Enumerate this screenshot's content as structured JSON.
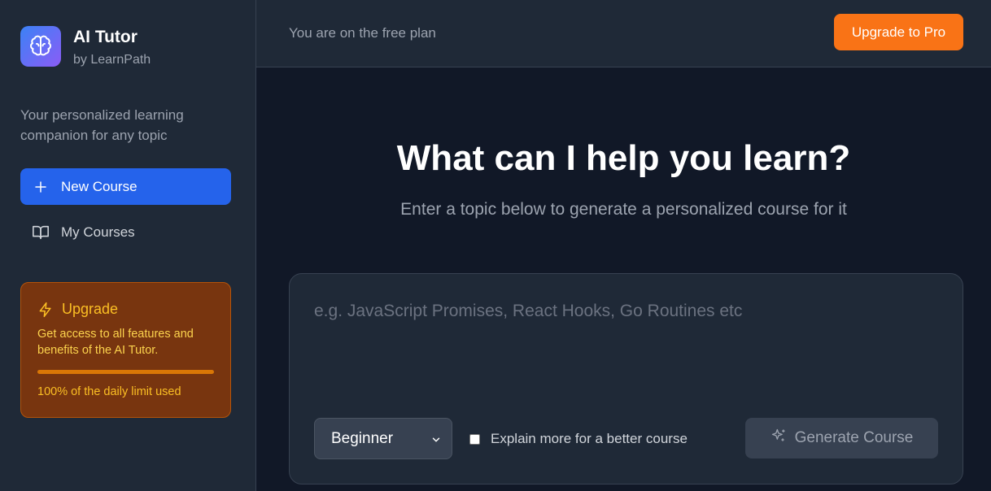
{
  "brand": {
    "title": "AI Tutor",
    "subtitle": "by LearnPath",
    "logo_icon": "brain-icon"
  },
  "sidebar": {
    "tagline": "Your personalized learning companion for any topic",
    "items": [
      {
        "label": "New Course",
        "icon": "plus-icon",
        "active": true
      },
      {
        "label": "My Courses",
        "icon": "book-open-icon",
        "active": false
      }
    ],
    "upgrade": {
      "title": "Upgrade",
      "icon": "lightning-icon",
      "description": "Get access to all features and benefits of the AI Tutor.",
      "usage_fraction": 1.0,
      "usage_text": "100% of the daily limit used"
    }
  },
  "header": {
    "plan_text": "You are on the free plan",
    "upgrade_button": "Upgrade to Pro"
  },
  "main": {
    "title": "What can I help you learn?",
    "subtitle": "Enter a topic below to generate a personalized course for it",
    "topic_input": {
      "value": "",
      "placeholder": "e.g. JavaScript Promises, React Hooks, Go Routines etc"
    },
    "difficulty": {
      "selected": "Beginner"
    },
    "explain_checkbox": {
      "label": "Explain more for a better course",
      "checked": false
    },
    "generate_button": {
      "label": "Generate Course",
      "icon": "sparkles-icon",
      "disabled": true
    }
  },
  "colors": {
    "background": "#111827",
    "sidebar": "#1f2937",
    "primary": "#2563eb",
    "accent_orange": "#f97316",
    "upgrade_bg": "#78350f",
    "upgrade_text": "#fbbf24"
  }
}
